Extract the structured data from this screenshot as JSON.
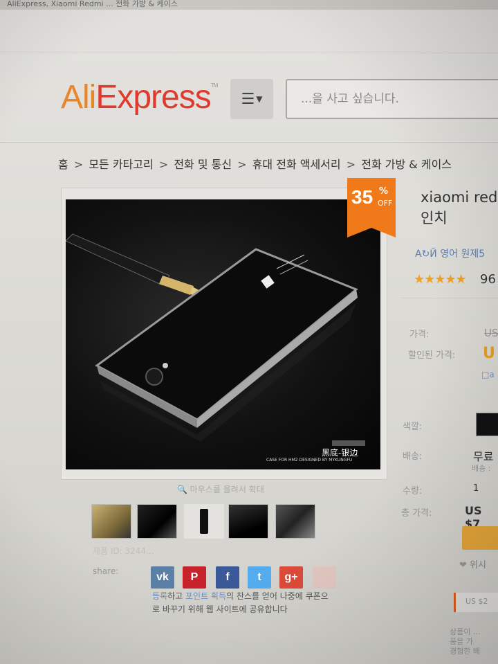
{
  "browser": {
    "top_text": "AliExpress, Xiaomi Redmi ... 전화 가방 & 케이스"
  },
  "header": {
    "logo_ali": "Ali",
    "logo_express": "Express",
    "logo_tm": "TM",
    "menu_icon": "hamburger-icon",
    "search_placeholder": "...을 사고 싶습니다."
  },
  "breadcrumb": [
    "홈",
    "모든 카타고리",
    "전화 및 통신",
    "휴대 전화 액세서리",
    "전화 가방 & 케이스"
  ],
  "breadcrumb_sep": ">",
  "product": {
    "discount_number": "35",
    "discount_pct": "%",
    "discount_off": "OFF",
    "title_line1": "xiaomi red",
    "title_line2": "인치",
    "translate_label": "영어 원제5",
    "rating_stars": "★★★★★",
    "rating_count": "96",
    "price_label": "가격:",
    "price_value": "US",
    "discount_price_label": "할인된 가격:",
    "discount_price_value": "U",
    "app_note": "a",
    "color_label": "색깔:",
    "shipping_label": "배송:",
    "shipping_value": "무료",
    "shipping_sub": "배송 :",
    "quantity_label": "수량:",
    "quantity_value": "1",
    "total_label": "총 가격:",
    "total_value": "US $7",
    "wishlist_label": "위시",
    "coupon_label": "US $2",
    "note_line1": "상품이 ...",
    "note_line2": "품을 가",
    "note_line3": "경험한 배"
  },
  "image": {
    "hover_hint": "마우스를 올려서 확대",
    "case_text_cn": "黑底-银边",
    "case_text_en": "CASE FOR HM2 DESIGNED BY MYKUNGFU"
  },
  "meta": {
    "product_id_label": "제품 ID: 3244...",
    "share_label": "share:"
  },
  "social": [
    {
      "name": "vk",
      "glyph": "vk",
      "color": "#5b7fa6"
    },
    {
      "name": "pinterest",
      "glyph": "P",
      "color": "#c8232c"
    },
    {
      "name": "facebook",
      "glyph": "f",
      "color": "#3b5998"
    },
    {
      "name": "twitter",
      "glyph": "t",
      "color": "#55acee"
    },
    {
      "name": "google-plus",
      "glyph": "g+",
      "color": "#dd4b39"
    },
    {
      "name": "extra",
      "glyph": "",
      "color": "#e2c8c0"
    }
  ],
  "coupon": {
    "link1": "등록",
    "text1": "하고 ",
    "link2": "포인트 획득",
    "text2": "의 찬스를 얻어 나중에 쿠폰으",
    "line2": "로 바꾸기 위해 웹 사이트에 공유합니다"
  }
}
